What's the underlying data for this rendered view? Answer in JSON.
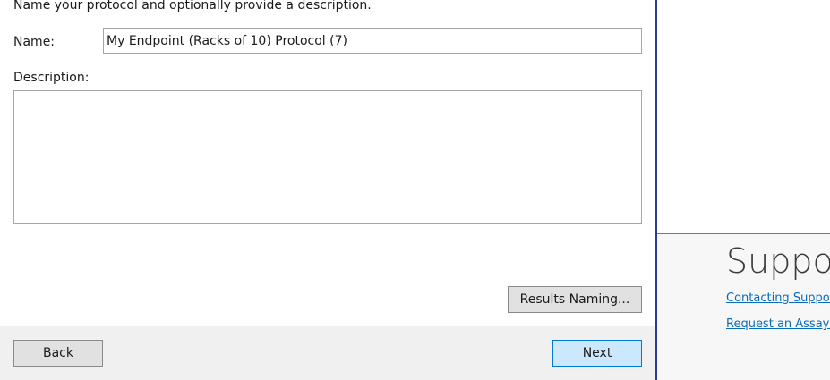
{
  "wizard": {
    "instruction": "Name your protocol and optionally provide a description.",
    "name_label": "Name:",
    "name_value": "My Endpoint (Racks of 10) Protocol (7)",
    "description_label": "Description:",
    "description_value": "",
    "results_naming_label": "Results Naming...",
    "back_label": "Back",
    "next_label": "Next"
  },
  "support_panel": {
    "title": "Suppor",
    "links": [
      {
        "label": "Contacting Suppor"
      },
      {
        "label": "Request an Assay P"
      }
    ]
  },
  "colors": {
    "divider": "#2b3a8c",
    "link": "#0b6cb8",
    "next_button_bg": "#cce8ff",
    "next_button_border": "#0078d7",
    "footer_bg": "#f0f0f0"
  }
}
